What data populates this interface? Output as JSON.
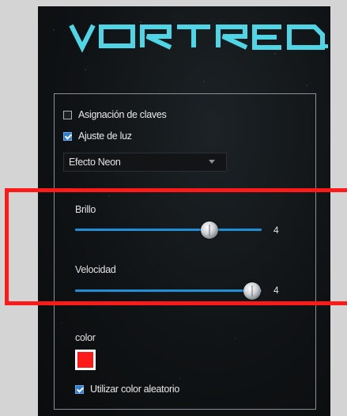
{
  "app": {
    "logo_text": "VORTRED",
    "colors": {
      "accent": "#1e8fd6",
      "logo": "#4fd6e6",
      "highlight": "#ff1a1a"
    }
  },
  "options": {
    "key_assignment": {
      "label": "Asignación de claves",
      "checked": false
    },
    "light_setting": {
      "label": "Ajuste de luz",
      "checked": true
    }
  },
  "effect_select": {
    "value": "Efecto Neon"
  },
  "brightness": {
    "label": "Brillo",
    "value": "4",
    "max": 5,
    "level": 0.72
  },
  "speed": {
    "label": "Velocidad",
    "value": "4",
    "max": 4,
    "level": 0.95
  },
  "color": {
    "label": "color",
    "swatch": "#ff1a1a",
    "random": {
      "label": "Utilizar color aleatorio",
      "checked": true
    }
  }
}
